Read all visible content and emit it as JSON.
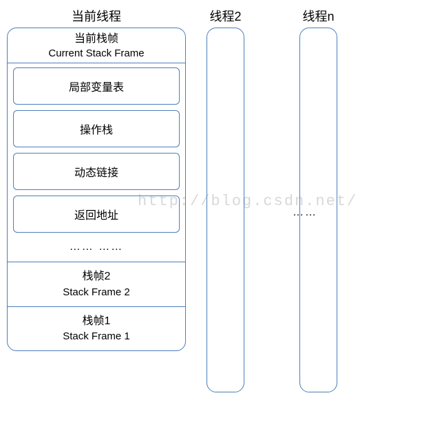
{
  "labels": {
    "current_thread": "当前线程",
    "thread2": "线程2",
    "threadn": "线程n"
  },
  "current_frame": {
    "title_cn": "当前栈帧",
    "title_en": "Current Stack Frame",
    "items": {
      "local_vars": "局部变量表",
      "operand_stack": "操作栈",
      "dynamic_link": "动态链接",
      "return_addr": "返回地址"
    },
    "more": "…… ……"
  },
  "frames": {
    "frame2_cn": "栈帧2",
    "frame2_en": "Stack Frame 2",
    "frame1_cn": "栈帧1",
    "frame1_en": "Stack Frame 1"
  },
  "ellipsis": "……",
  "watermark": "http://blog.csdn.net/"
}
